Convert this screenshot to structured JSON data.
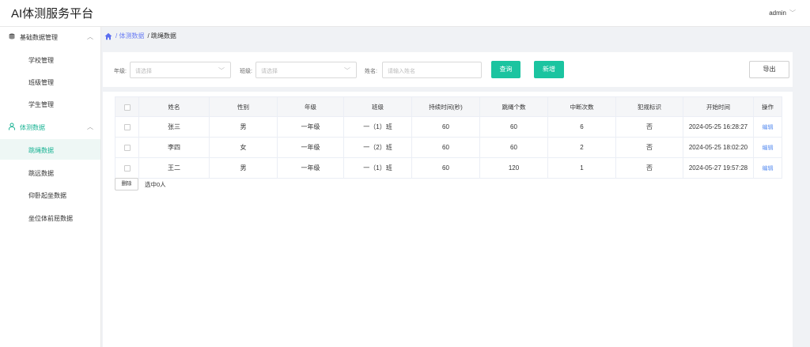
{
  "app": {
    "title": "AI体测服务平台",
    "user": "admin"
  },
  "sidebar": {
    "groups": [
      {
        "label": "基础数据管理",
        "items": [
          "学校管理",
          "班级管理",
          "学生管理"
        ]
      },
      {
        "label": "体测数据",
        "items": [
          "跳绳数据",
          "跳远数据",
          "仰卧起坐数据",
          "坐位体前屈数据"
        ]
      }
    ]
  },
  "breadcrumb": {
    "parent": "/ 体测数据",
    "current": "/ 跳绳数据"
  },
  "filters": {
    "grade_label": "年级:",
    "grade_placeholder": "请选择",
    "class_label": "班级:",
    "class_placeholder": "请选择",
    "name_label": "姓名:",
    "name_placeholder": "请输入姓名",
    "query_label": "查询",
    "add_label": "新增",
    "export_label": "导出"
  },
  "table": {
    "headers": [
      "姓名",
      "性别",
      "年级",
      "班级",
      "持续时间(秒)",
      "跳绳个数",
      "中断次数",
      "犯规标识",
      "开始时间",
      "操作"
    ],
    "rows": [
      [
        "张三",
        "男",
        "一年级",
        "一（1）班",
        "60",
        "60",
        "6",
        "否",
        "2024-05-25 16:28:27",
        "编辑"
      ],
      [
        "李四",
        "女",
        "一年级",
        "一（2）班",
        "60",
        "60",
        "2",
        "否",
        "2024-05-25 18:02:20",
        "编辑"
      ],
      [
        "王二",
        "男",
        "一年级",
        "一（1）班",
        "60",
        "120",
        "1",
        "否",
        "2024-05-27 19:57:28",
        "编辑"
      ]
    ]
  },
  "footer": {
    "delete_label": "删除",
    "selected_text": "选中0人"
  },
  "colors": {
    "accent": "#1bc4a0",
    "link": "#5b8ff0",
    "breadcrumb_link": "#6a7df4"
  }
}
